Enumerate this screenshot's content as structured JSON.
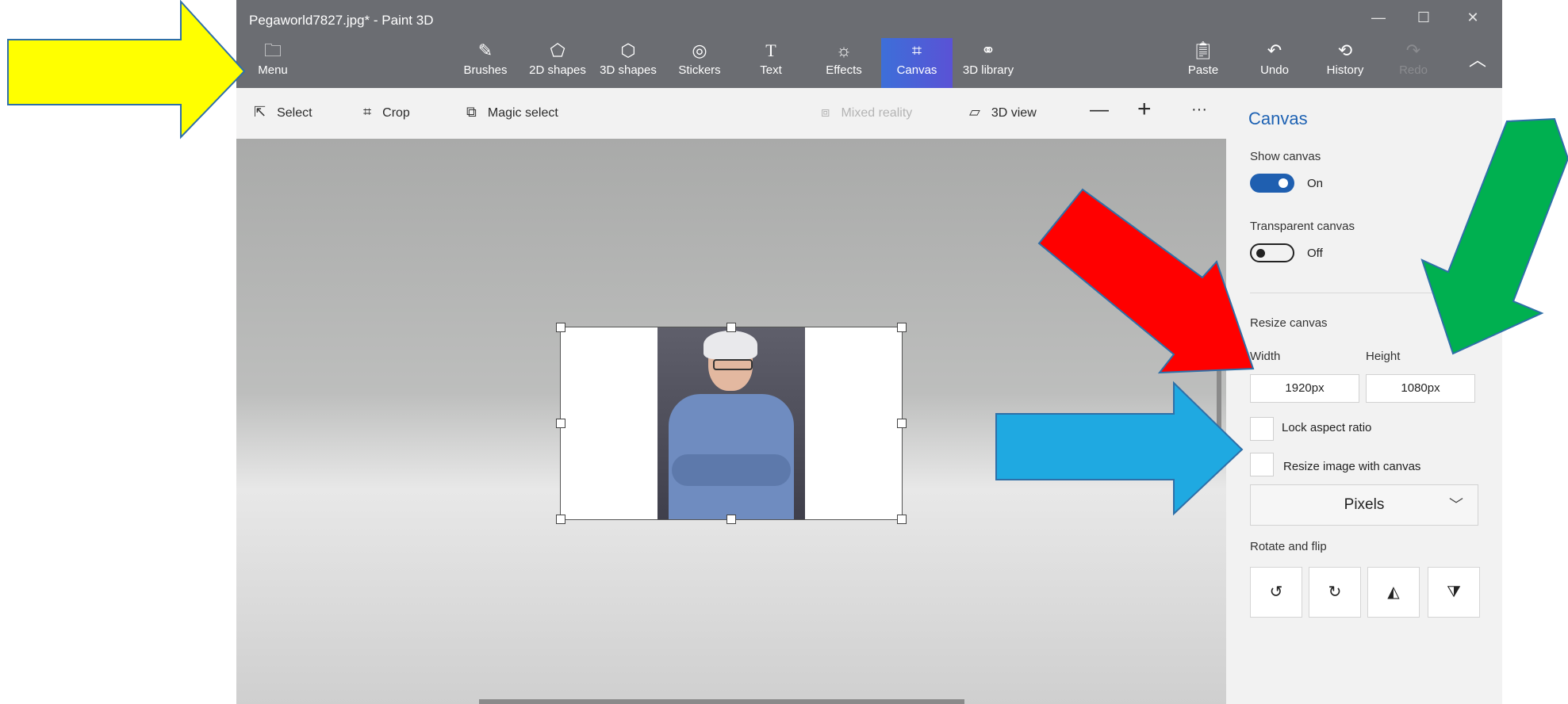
{
  "window": {
    "title": "Pegaworld7827.jpg* - Paint 3D"
  },
  "window_controls": {
    "minimize": "—",
    "maximize": "☐",
    "close": "✕"
  },
  "ribbon": {
    "menu": {
      "label": "Menu",
      "icon": "folder-icon"
    },
    "items": [
      {
        "label": "Brushes",
        "icon": "brush-icon"
      },
      {
        "label": "2D shapes",
        "icon": "2d-shapes-icon"
      },
      {
        "label": "3D shapes",
        "icon": "cube-icon"
      },
      {
        "label": "Stickers",
        "icon": "sticker-icon"
      },
      {
        "label": "Text",
        "icon": "text-icon"
      },
      {
        "label": "Effects",
        "icon": "sun-icon"
      },
      {
        "label": "Canvas",
        "icon": "canvas-icon",
        "active": true
      },
      {
        "label": "3D library",
        "icon": "library-icon"
      }
    ],
    "right": [
      {
        "label": "Paste",
        "icon": "clipboard-icon"
      },
      {
        "label": "Undo",
        "icon": "undo-icon"
      },
      {
        "label": "History",
        "icon": "history-icon"
      },
      {
        "label": "Redo",
        "icon": "redo-icon",
        "disabled": true
      }
    ],
    "collapse_icon": "chevron-up-icon"
  },
  "toolbar": {
    "select": "Select",
    "crop": "Crop",
    "magic_select": "Magic select",
    "mixed_reality": "Mixed reality",
    "view_3d": "3D view",
    "zoom_out": "—",
    "zoom_in": "+",
    "more": "···"
  },
  "panel": {
    "title": "Canvas",
    "show_canvas": {
      "label": "Show canvas",
      "state": "On"
    },
    "transparent_canvas": {
      "label": "Transparent canvas",
      "state": "Off"
    },
    "resize": {
      "label": "Resize canvas",
      "width_label": "Width",
      "height_label": "Height",
      "width_value": "1920px",
      "height_value": "1080px"
    },
    "lock_aspect": "Lock aspect ratio",
    "resize_image": "Resize image with canvas",
    "units": "Pixels",
    "rotate_flip": "Rotate and flip"
  },
  "colors": {
    "yellow_arrow": "#ffff00",
    "red_arrow": "#ff0000",
    "green_arrow": "#00b050",
    "blue_arrow": "#1fa9e1",
    "accent": "#1f5fb0"
  }
}
